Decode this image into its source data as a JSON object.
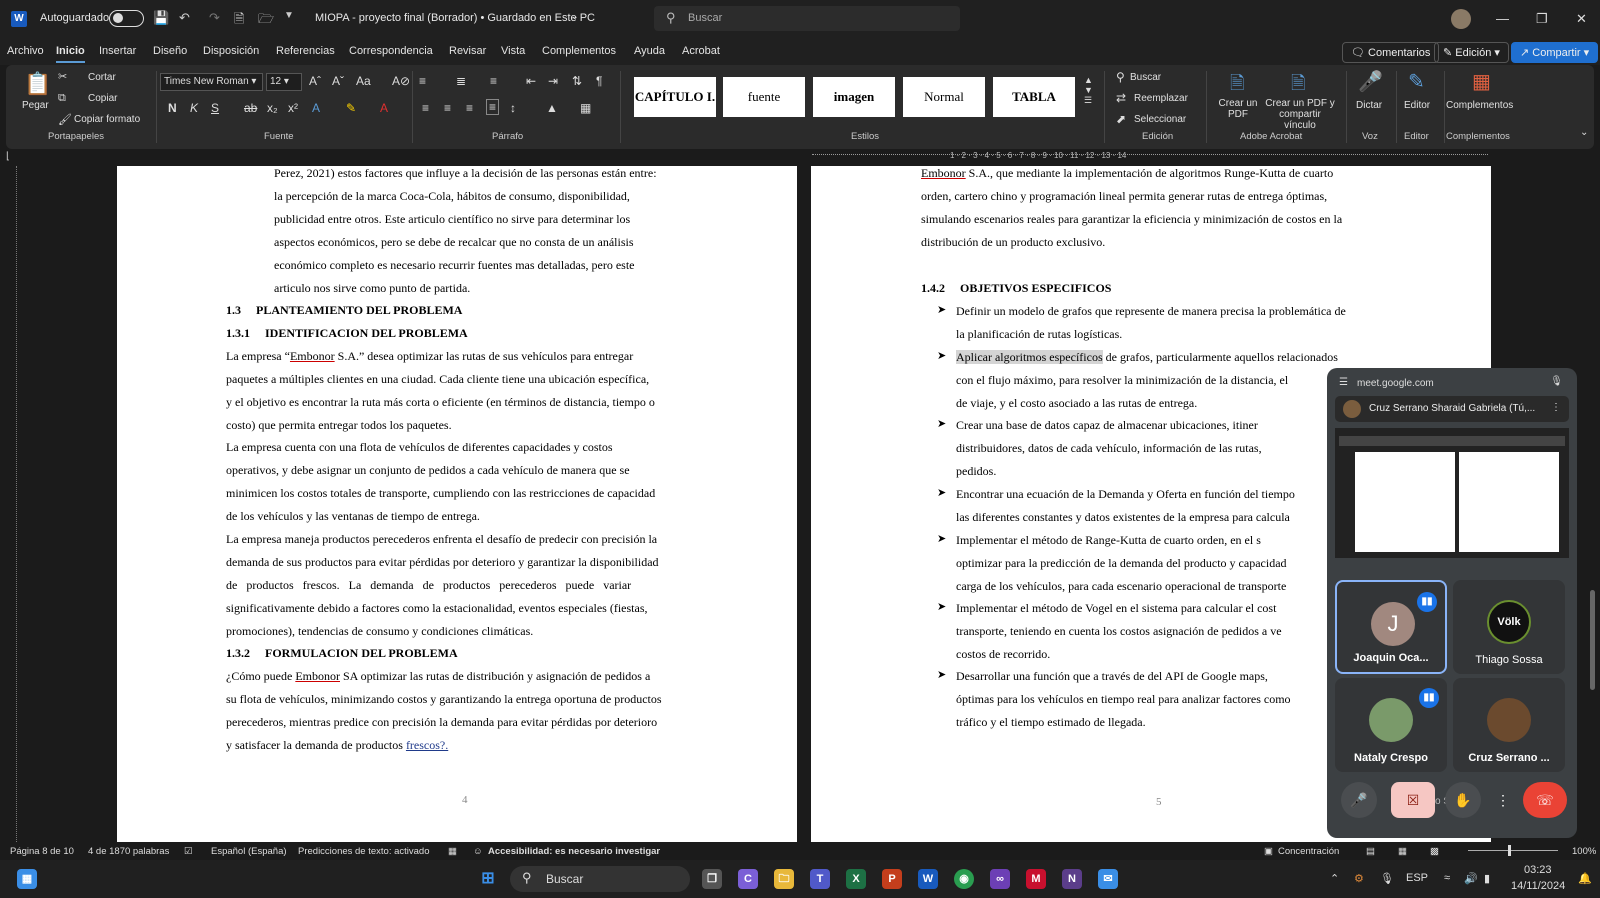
{
  "titlebar": {
    "autosave_label": "Autoguardado",
    "doc_title": "MIOPA - proyecto final (Borrador) • Guardado en Este PC",
    "search_placeholder": "Buscar"
  },
  "menu": {
    "items": [
      "Archivo",
      "Inicio",
      "Insertar",
      "Diseño",
      "Disposición",
      "Referencias",
      "Correspondencia",
      "Revisar",
      "Vista",
      "Complementos",
      "Ayuda",
      "Acrobat"
    ],
    "active": "Inicio",
    "comentarios": "Comentarios",
    "edicion": "Edición",
    "compartir": "Compartir"
  },
  "ribbon": {
    "pegar": "Pegar",
    "cortar": "Cortar",
    "copiar": "Copiar",
    "copiar_formato": "Copiar formato",
    "portapapeles": "Portapapeles",
    "font_name": "Times New Roman",
    "font_size": "12",
    "fuente_group": "Fuente",
    "parrafo_group": "Párrafo",
    "estilos_group": "Estilos",
    "styles": [
      "CAPÍTULO I.",
      "fuente",
      "imagen",
      "Normal",
      "TABLA"
    ],
    "buscar": "Buscar",
    "reemplazar": "Reemplazar",
    "seleccionar": "Seleccionar",
    "edicion_group": "Edición",
    "crear_pdf": "Crear un PDF",
    "crear_pdf_vinculo": "Crear un PDF y compartir vínculo",
    "adobe_group": "Adobe Acrobat",
    "dictar": "Dictar",
    "voz_group": "Voz",
    "editor": "Editor",
    "editor_group": "Editor",
    "complementos": "Complementos",
    "complementos_group": "Complementos"
  },
  "ruler_numbers": "1 · 2 · 3 · 4 · 5 · 6 · 7 · 8 · 9 · 10 · 11 · 12 · 13 · 14",
  "page4": {
    "lines": [
      "Perez, 2021) estos factores que influye a la decisión de las personas están entre:",
      "la percepción de la marca Coca-Cola, hábitos de consumo, disponibilidad,",
      "publicidad entre otros. Este articulo científico no sirve para determinar los",
      "aspectos económicos, pero se debe de recalcar que no consta de un análisis",
      "económico completo es necesario recurrir fuentes mas detalladas, pero este",
      "articulo nos sirve como punto de partida."
    ],
    "h13": "1.3     PLANTEAMIENTO DEL PROBLEMA",
    "h131": "1.3.1     IDENTIFICACION DEL PROBLEMA",
    "p1_pre": "La empresa “",
    "p1_word": "Embonor",
    "p1_post": " S.A.” desea optimizar las rutas de sus vehículos para entregar",
    "p1": [
      "paquetes a múltiples clientes en una ciudad. Cada cliente tiene una ubicación específica,",
      "y el objetivo es encontrar la ruta más corta o eficiente (en términos de distancia, tiempo o",
      "costo) que permita entregar todos los paquetes."
    ],
    "p2": [
      "La empresa cuenta con una flota de vehículos de diferentes capacidades y costos",
      "operativos, y debe asignar un conjunto de pedidos a cada vehículo de manera que se",
      "minimicen los costos totales de transporte, cumpliendo con las restricciones de capacidad",
      "de los vehículos y las ventanas de tiempo de entrega."
    ],
    "p3": [
      "La empresa maneja productos perecederos enfrenta el desafío de predecir con precisión la",
      "demanda de sus productos para evitar pérdidas por deterioro y garantizar la disponibilidad",
      "de   productos   frescos.   La   demanda   de   productos   perecederos   puede   variar",
      "significativamente debido a factores como la estacionalidad, eventos especiales (fiestas,",
      "promociones), tendencias de consumo y condiciones climáticas."
    ],
    "h132": "1.3.2     FORMULACION DEL PROBLEMA",
    "p4_pre": "¿Cómo puede ",
    "p4_word": "Embonor",
    "p4_post": " SA optimizar las rutas de distribución y asignación de pedidos a",
    "p4": [
      "su flota de vehículos, minimizando costos y garantizando la entrega oportuna de productos",
      "perecederos, mientras predice con precisión la demanda para evitar pérdidas por deterioro"
    ],
    "p4_last_pre": "y satisfacer la demanda de productos ",
    "p4_last_word": "frescos?.",
    "page_number": "4"
  },
  "page5": {
    "top_word": "Embonor",
    "top_rest": " S.A., que mediante la implementación de algoritmos Runge-Kutta de cuarto",
    "top": [
      "orden, cartero chino y programación lineal permita generar rutas de entrega óptimas,",
      "simulando escenarios reales para garantizar la eficiencia y minimización de costos en la",
      "distribución de un producto exclusivo."
    ],
    "h142": "1.4.2     OBJETIVOS ESPECIFICOS",
    "bullets": [
      [
        "Definir un modelo de grafos que represente de manera precisa la problemática de",
        "la planificación de rutas logísticas."
      ],
      [
        "Aplicar algoritmos específicos de grafos, particularmente aquellos relacionados",
        "con el flujo máximo, para resolver la minimización de la distancia, el",
        "de viaje, y el costo asociado a las rutas de entrega."
      ],
      [
        "Crear una base de datos capaz de almacenar ubicaciones, itiner",
        "distribuidores, datos de cada vehículo, información de las rutas,",
        "pedidos."
      ],
      [
        "Encontrar una ecuación de la Demanda y Oferta en función del tiempo",
        "las diferentes constantes y datos existentes de la empresa para calcula"
      ],
      [
        "Implementar el método de Range-Kutta de cuarto orden, en el s",
        "optimizar para la predicción de la demanda del producto y capacidad",
        "carga de los vehículos, para cada escenario operacional de transporte"
      ],
      [
        "Implementar el método de Vogel en el sistema para calcular el cost",
        "transporte, teniendo en cuenta los costos asignación de pedidos a ve",
        "costos de recorrido."
      ],
      [
        "Desarrollar una función que a través de del API de Google maps,",
        "óptimas para los vehículos en tiempo real para analizar factores como",
        "tráfico y el tiempo estimado de llegada."
      ]
    ],
    "highlight": "Aplicar algoritmos específicos",
    "page_number": "5"
  },
  "meet": {
    "url": "meet.google.com",
    "tab_title": "Cruz Serrano Sharaid Gabriela (Tú,...",
    "participants": [
      {
        "name": "Joaquin Oca...",
        "initial": "J",
        "speaking": true
      },
      {
        "name": "Thiago Sossa",
        "initial": "Völk",
        "speaking": false
      },
      {
        "name": "Nataly Crespo",
        "initial": "",
        "speaking": true
      },
      {
        "name": "Cruz Serrano ...",
        "initial": "",
        "speaking": false
      }
    ],
    "overlay_text": "o Sossa"
  },
  "status": {
    "page": "Página 8 de 10",
    "words": "4 de 1870 palabras",
    "language": "Español (España)",
    "predictions": "Predicciones de texto: activado",
    "accessibility": "Accesibilidad: es necesario investigar",
    "focus": "Concentración",
    "zoom": "100%"
  },
  "taskbar": {
    "search": "Buscar",
    "lang": "ESP",
    "time": "03:23",
    "date": "14/11/2024"
  },
  "colors": {
    "word_blue": "#185abd",
    "meet_active": "#8ab4f8",
    "end_call": "#ea4335"
  }
}
